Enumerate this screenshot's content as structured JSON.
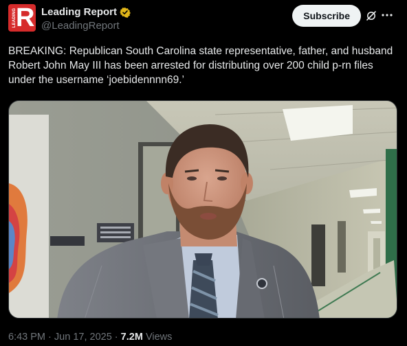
{
  "author": {
    "display_name": "Leading Report",
    "handle": "@LeadingReport",
    "avatar_letter": "R",
    "avatar_side_text": "LEADING",
    "verified_color": "#e2b719"
  },
  "actions": {
    "subscribe_label": "Subscribe"
  },
  "tweet": {
    "text": "BREAKING: Republican South Carolina state representative, father, and husband Robert John May III has been arrested for distributing over 200 child p-rn files under the username ‘joebidennnn69.’"
  },
  "meta": {
    "time": "6:43 PM",
    "separator": "·",
    "date": "Jun 17, 2025",
    "views_count": "7.2M",
    "views_label": "Views"
  },
  "media": {
    "description_icon": "video-still"
  },
  "colors": {
    "background": "#000000",
    "text": "#e7e9ea",
    "secondary_text": "#71767b",
    "brand_red": "#d62b2b"
  }
}
